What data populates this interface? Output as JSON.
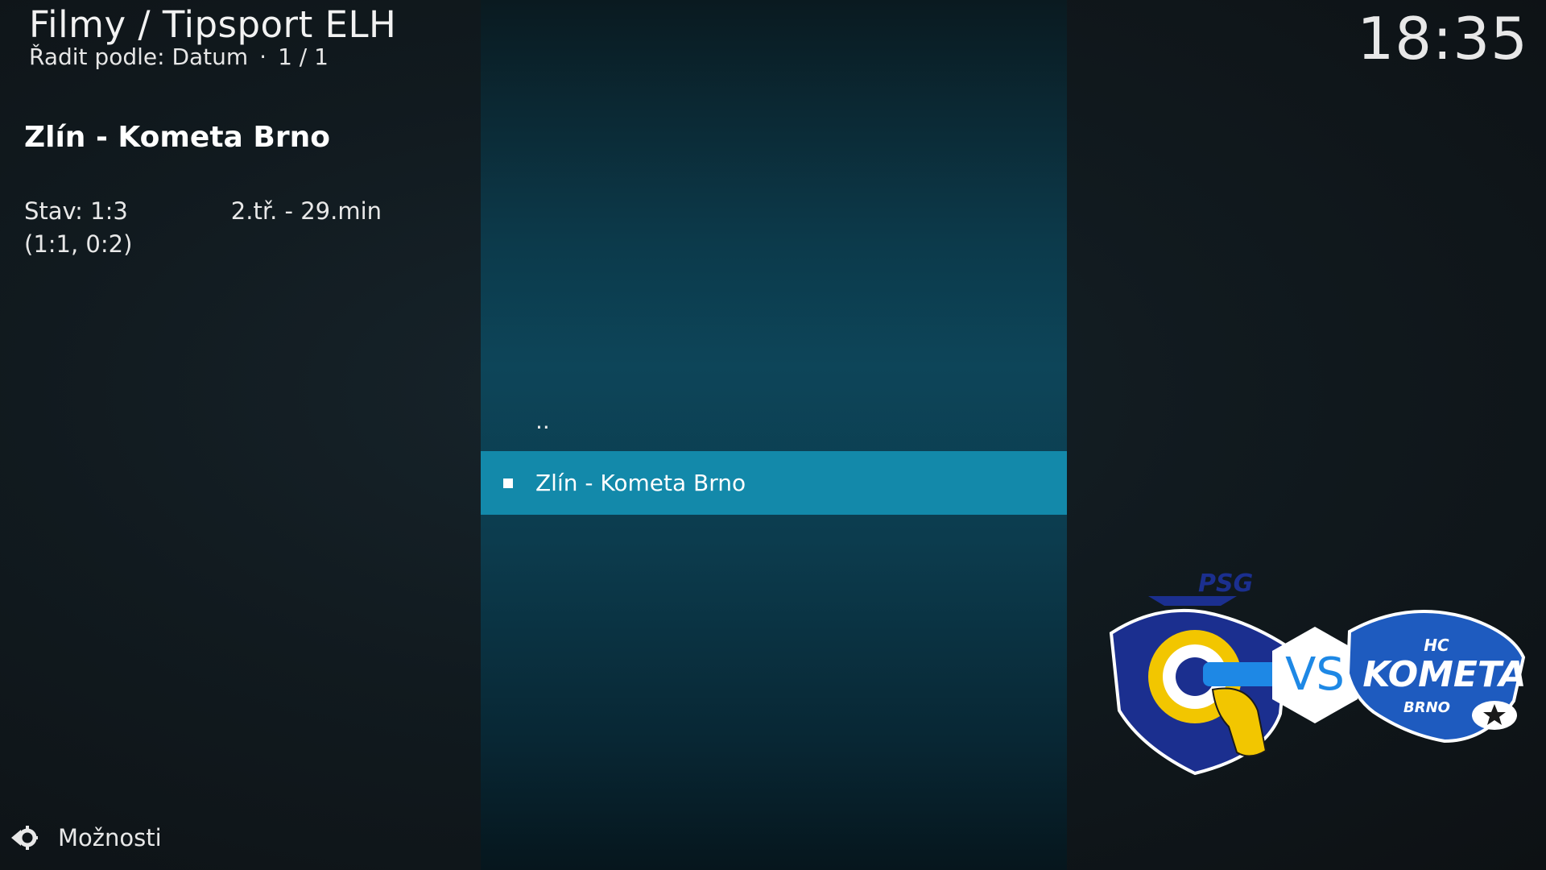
{
  "header": {
    "breadcrumb": "Filmy / Tipsport ELH",
    "sort_label": "Řadit podle: Datum",
    "separator": "·",
    "page_count": "1 / 1",
    "clock": "18:35"
  },
  "info": {
    "title": "Zlín - Kometa Brno",
    "plot_part1": "Stav: 1:3",
    "plot_part2": "2.tř. - 29.min (1:1, 0:2)"
  },
  "list": {
    "items": [
      {
        "label": "..",
        "selected": false
      },
      {
        "label": "Zlín - Kometa Brno",
        "selected": true
      }
    ]
  },
  "poster": {
    "vs_text": "VS",
    "left_team_mark": "PSG",
    "right_team_top": "HC",
    "right_team_name": "KOMETA",
    "right_team_city": "BRNO"
  },
  "footer": {
    "options_label": "Možnosti",
    "options_icon": "gear-arrow-icon"
  },
  "colors": {
    "selection": "#1389aa",
    "panel": "#0d4559",
    "background": "#101417"
  }
}
